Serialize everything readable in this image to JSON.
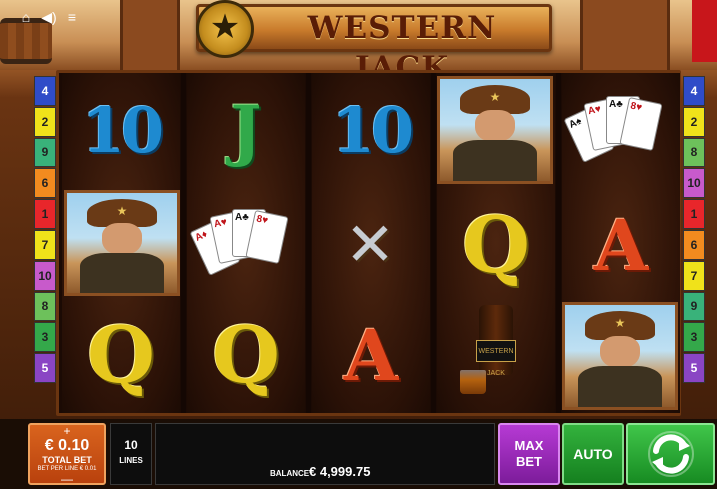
{
  "game": {
    "title": "WESTERN JACK"
  },
  "top_icons": {
    "home": "home-icon",
    "sound": "sound-icon",
    "menu": "menu-icon"
  },
  "paylines": {
    "left": [
      "4",
      "2",
      "9",
      "6",
      "1",
      "7",
      "10",
      "8",
      "3",
      "5"
    ],
    "right": [
      "4",
      "2",
      "8",
      "10",
      "1",
      "6",
      "7",
      "9",
      "3",
      "5"
    ],
    "colors": {
      "1": "#e8262b",
      "2": "#f0e21a",
      "3": "#34a84a",
      "4": "#2f4cc8",
      "5": "#8a45c4",
      "6": "#f28b1f",
      "7": "#f0e21a",
      "8": "#6dc15b",
      "9": "#39b27a",
      "10": "#c85acb"
    }
  },
  "reels": [
    [
      "10",
      "cowboy",
      "Q"
    ],
    [
      "J",
      "cards",
      "Q"
    ],
    [
      "10",
      "guns",
      "A"
    ],
    [
      "cowboy",
      "Q",
      "whiskey"
    ],
    [
      "cards",
      "A",
      "cowboy"
    ]
  ],
  "symbols": {
    "ten": "10",
    "jack": "J",
    "queen": "Q",
    "ace": "A",
    "bottle_label": "WESTERN JACK"
  },
  "controls": {
    "plus": "+",
    "minus": "—",
    "bet_value": "€ 0.10",
    "total_bet_label": "TOTAL BET",
    "bet_per_line": "BET PER LINE € 0.01",
    "lines_value": "10",
    "lines_label": "LINES",
    "balance_label": "BALANCE",
    "balance_value": "€ 4,999.75",
    "max_bet_label": "MAX BET",
    "auto_label": "AUTO"
  },
  "colors": {
    "bet_orange": "#c9521a",
    "max_bet_purple": "#9b2abb",
    "auto_green": "#24992f",
    "spin_green": "#2eab38"
  }
}
